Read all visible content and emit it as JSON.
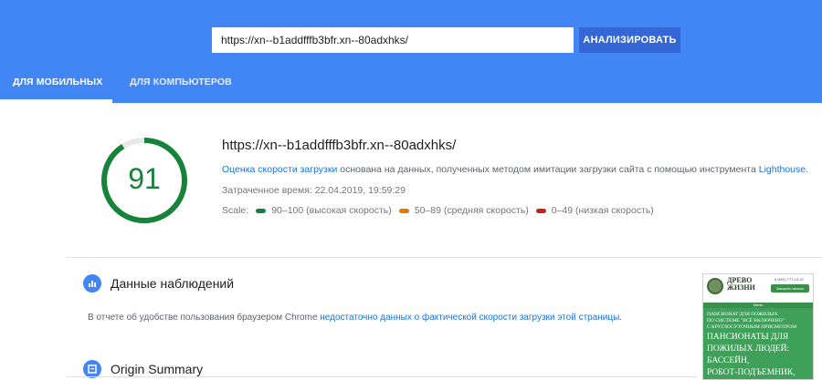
{
  "header": {
    "url_value": "https://xn--b1addfffb3bfr.xn--80adxhks/",
    "analyze_label": "АНАЛИЗИРОВАТЬ",
    "tabs": [
      {
        "label": "ДЛЯ МОБИЛЬНЫХ",
        "active": true
      },
      {
        "label": "ДЛЯ КОМПЬЮТЕРОВ",
        "active": false
      }
    ],
    "color": "#4285f4"
  },
  "summary": {
    "score": "91",
    "score_fraction": 0.91,
    "score_color": "#178239",
    "url": "https://xn--b1addfffb3bfr.xn--80adxhks/",
    "desc_link1": "Оценка скорости загрузки",
    "desc_middle": " основана на данных, полученных методом имитации загрузки сайта с помощью инструмента ",
    "desc_link2": "Lighthouse",
    "desc_end": ".",
    "elapsed": "Затраченное время: 22.04.2019, 19:59:29",
    "scale_label": "Scale:",
    "scale": [
      {
        "label": "90–100 (высокая скорость)",
        "color": "#178239"
      },
      {
        "label": "50–89 (средняя скорость)",
        "color": "#e67700"
      },
      {
        "label": "0–49 (низкая скорость)",
        "color": "#c7221f"
      }
    ]
  },
  "field_data": {
    "title": "Данные наблюдений",
    "text_before": "В отчете об удобстве пользования браузером Chrome ",
    "link": "недостаточно данных о фактической скорости загрузки этой страницы",
    "text_after": "."
  },
  "origin": {
    "title": "Origin Summary"
  },
  "screenshot": {
    "brand_line1": "ДРЕВО",
    "brand_line2": "ЖИЗНИ",
    "phone": "8 (800) 777-13-47",
    "call_btn": "Заказать звонок",
    "menu": "Меню",
    "small_lines": [
      "ПАНСИОНАТ ДЛЯ ПОЖИЛЫХ",
      "ПО СИСТЕМЕ \"ВСЁ ВКЛЮЧЕНО\"",
      "С КРУГЛОСУТОЧНЫМ ПРИСМОТРОМ"
    ],
    "big_lines": [
      "ПАНСИОНАТЫ ДЛЯ",
      "ПОЖИЛЫХ ЛЮДЕЙ:",
      "БАССЕЙН,",
      "РОБОТ-ПОДЪЕМНИК,"
    ]
  }
}
